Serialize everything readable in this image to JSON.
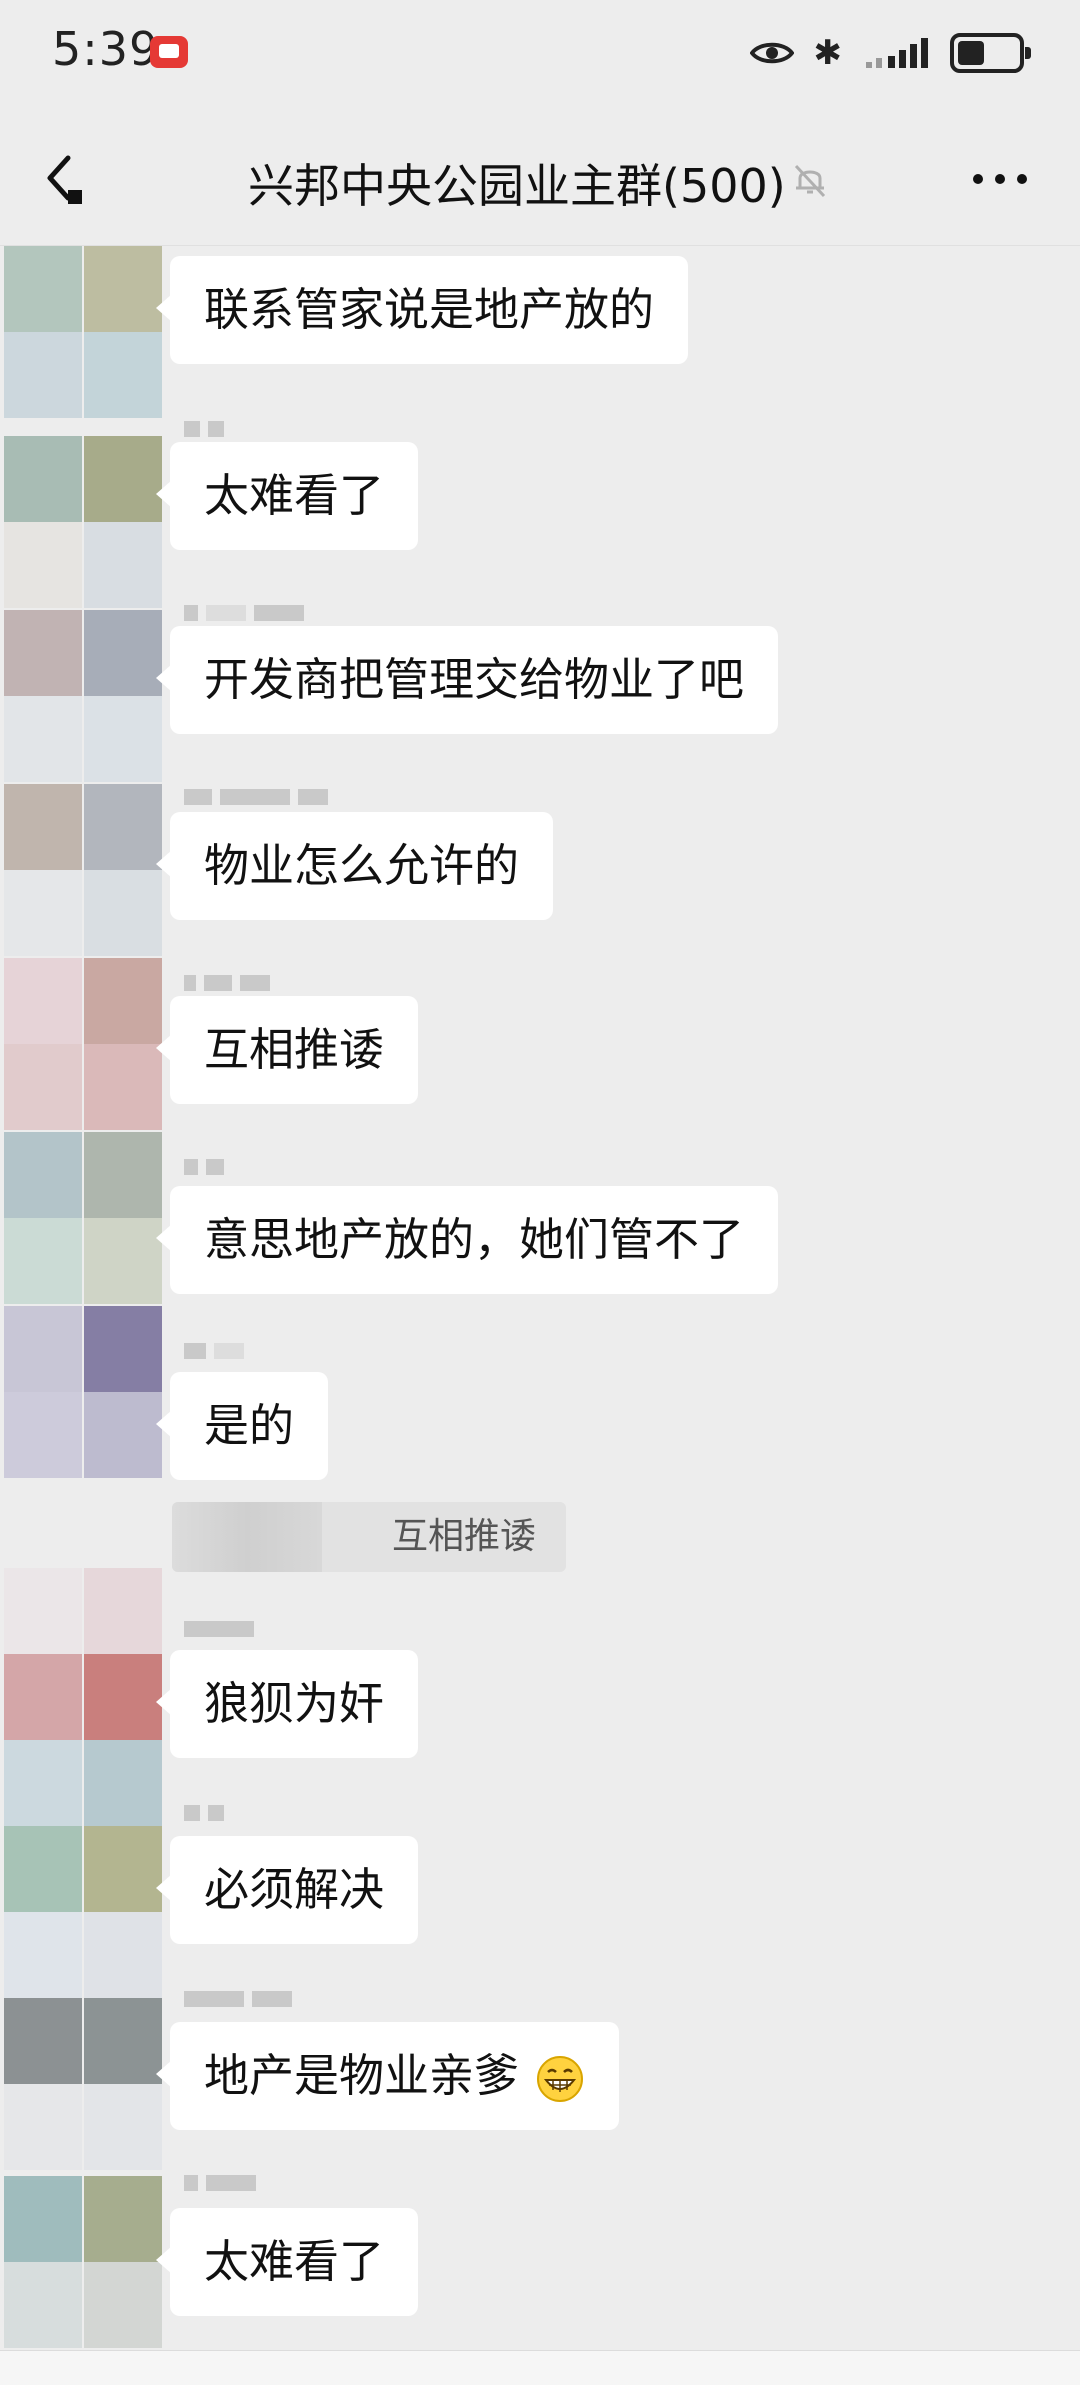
{
  "status_bar": {
    "time": "5:39",
    "battery_level": 0.45
  },
  "nav": {
    "title": "兴邦中央公园业主群(500)"
  },
  "messages": [
    {
      "text": "联系管家说是地产放的"
    },
    {
      "text": "太难看了"
    },
    {
      "text": "开发商把管理交给物业了吧"
    },
    {
      "text": "物业怎么允许的"
    },
    {
      "text": "互相推诿"
    },
    {
      "text": "意思地产放的，她们管不了"
    },
    {
      "text": "是的"
    },
    {
      "text": "狼狈为奸"
    },
    {
      "text": "必须解决"
    },
    {
      "text": "地产是物业亲爹",
      "emoji": "grin-icon"
    },
    {
      "text": "太难看了"
    }
  ],
  "quote": {
    "text": "互相推诿"
  },
  "colors": {
    "background": "#ededed",
    "bubble": "#ffffff",
    "quote_bg": "#e2e2e2"
  }
}
